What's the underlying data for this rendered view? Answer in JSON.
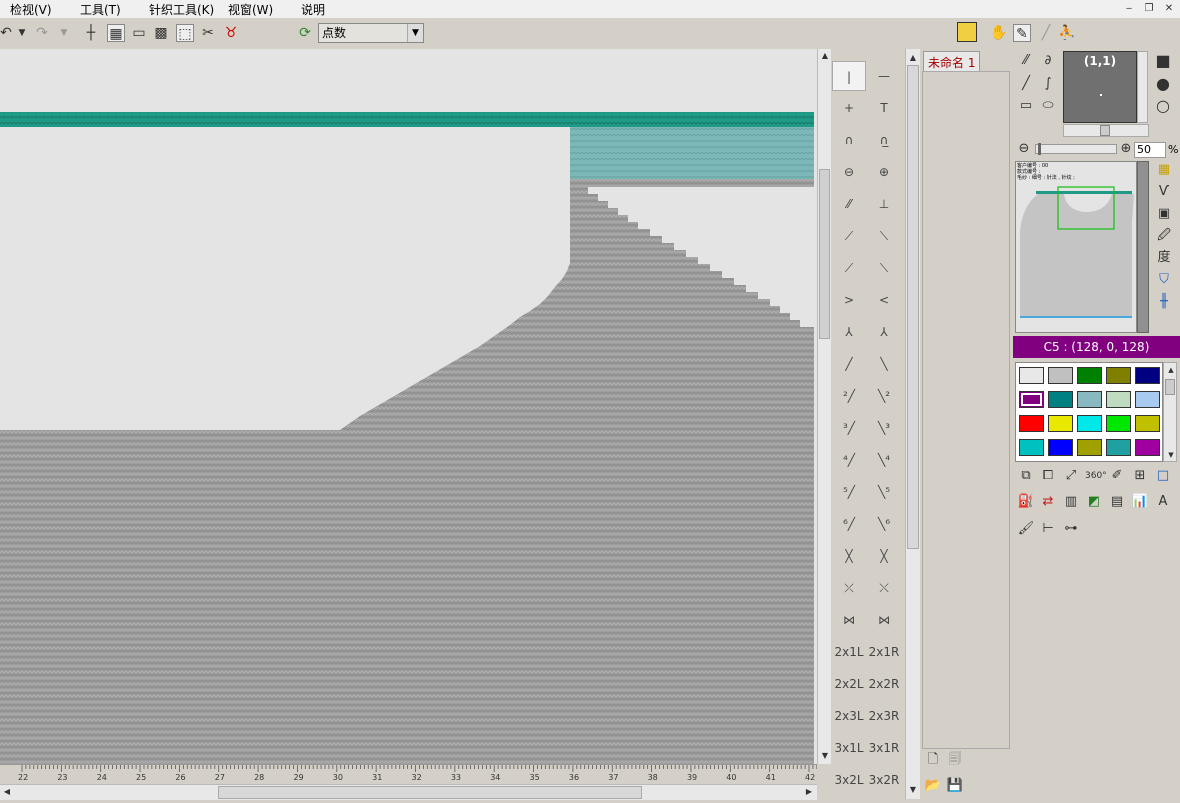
{
  "menu": {
    "items": [
      "检视(V)",
      "工具(T)",
      "针织工具(K)",
      "视窗(W)",
      "说明"
    ]
  },
  "toolbar": {
    "select_value": "点数",
    "icons": [
      "undo-icon",
      "dropdown-icon",
      "redo-icon",
      "dropdown-icon",
      "crosshair-icon",
      "grid-icon",
      "select-rect-icon",
      "mesh-icon",
      "select-tool-icon",
      "lasso-icon",
      "mask-icon",
      "refresh-icon"
    ],
    "right_icons": [
      "garment-icon",
      "hand-icon",
      "pen-icon",
      "line-icon",
      "pointer-icon"
    ]
  },
  "ruler": {
    "labels": [
      "22",
      "23",
      "24",
      "25",
      "26",
      "27",
      "28",
      "29",
      "30",
      "31",
      "32",
      "33",
      "34",
      "35",
      "36",
      "37",
      "38",
      "39",
      "40",
      "41",
      "42"
    ]
  },
  "stitch_panel": {
    "rows": [
      [
        "|",
        "—"
      ],
      [
        "+",
        "T"
      ],
      [
        "∩",
        "∩̲"
      ],
      [
        "⊖",
        "⊕"
      ],
      [
        "⁄⁄",
        "⊥"
      ],
      [
        "⟋",
        "⟍"
      ],
      [
        "⟋",
        "⟍"
      ],
      [
        ">",
        "<"
      ],
      [
        "⅄",
        "⅄"
      ],
      [
        "╱",
        "╲"
      ],
      [
        "²╱",
        "╲²"
      ],
      [
        "³╱",
        "╲³"
      ],
      [
        "⁴╱",
        "╲⁴"
      ],
      [
        "⁵╱",
        "╲⁵"
      ],
      [
        "⁶╱",
        "╲⁶"
      ],
      [
        "╳",
        "╳"
      ],
      [
        "⤫",
        "⤬"
      ],
      [
        "⋈",
        "⋈"
      ],
      [
        "2x1L",
        "2x1R"
      ],
      [
        "2x2L",
        "2x2R"
      ],
      [
        "2x3L",
        "2x3R"
      ],
      [
        "3x1L",
        "3x1R"
      ],
      [
        "3x2L",
        "3x2R"
      ]
    ]
  },
  "doc_panel": {
    "tab_label": "未命名 1"
  },
  "navigator": {
    "coord": "(1,1)",
    "zoom_value": "50",
    "zoom_unit": "%",
    "preview_lines": [
      "客户编号 : 00",
      "款式编号 :",
      "毛纱 : 细号 : 针法 , 针纹 ;"
    ]
  },
  "color": {
    "header": "C5 : (128, 0, 128)",
    "swatches": [
      "#e8e8e8",
      "#c0c0c0",
      "#008000",
      "#808000",
      "#000080",
      "#800080",
      "#008080",
      "#88b8c0",
      "#c0dcc0",
      "#a6caf0",
      "#ff0000",
      "#e8e800",
      "#00e8e8",
      "#00e800",
      "#c0c000",
      "#00c0c0",
      "#0000ff",
      "#a0a000",
      "#20a0a0",
      "#a000a0"
    ],
    "selected_index": 5
  },
  "colors": {
    "teal_band": "#1f9a86",
    "teal_light": "#7cb8b8",
    "knit_gray": "#a0a0a0",
    "canvas_bg": "#e4e4e4"
  }
}
